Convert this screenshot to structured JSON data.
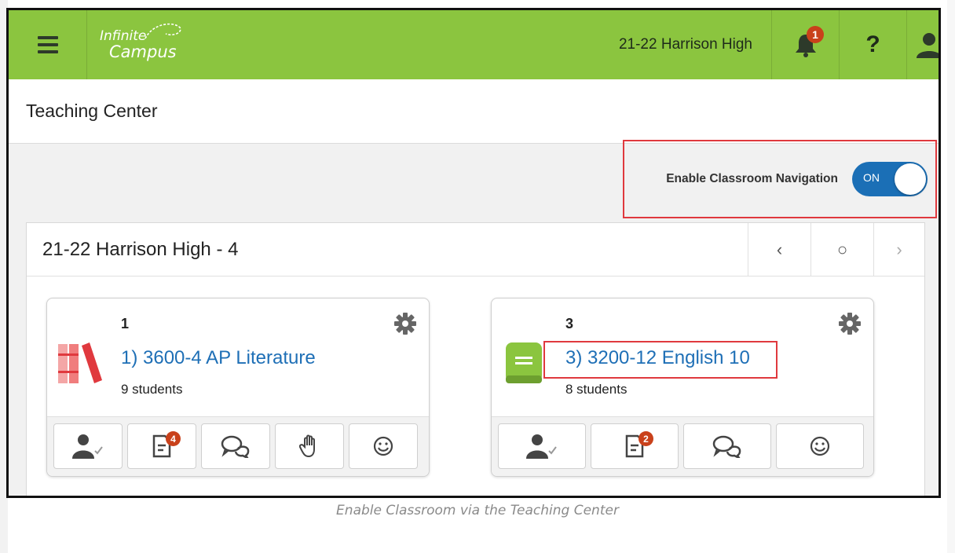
{
  "topbar": {
    "logo_line1": "Infinite",
    "logo_line2": "Campus",
    "school": "21-22 Harrison High",
    "notification_count": "1",
    "help_label": "?",
    "icons": {
      "menu": "hamburger-icon",
      "bell": "bell-icon",
      "user": "user-icon"
    }
  },
  "page_title": "Teaching Center",
  "toggle": {
    "label": "Enable Classroom Navigation",
    "state": "ON"
  },
  "term": {
    "title": "21-22 Harrison High - 4",
    "nav": {
      "prev": "‹",
      "home": "○",
      "next": "›"
    }
  },
  "courses": [
    {
      "period": "1",
      "name": "1) 3600-4 AP Literature",
      "students": "9 students",
      "icon": "books-icon",
      "actions": [
        {
          "name": "attendance-icon"
        },
        {
          "name": "grade-book-icon",
          "badge": "4"
        },
        {
          "name": "messages-icon"
        },
        {
          "name": "hand-raise-icon"
        },
        {
          "name": "smiley-icon"
        }
      ]
    },
    {
      "period": "3",
      "name": "3) 3200-12 English 10",
      "students": "8 students",
      "icon": "book-icon",
      "actions": [
        {
          "name": "attendance-icon"
        },
        {
          "name": "grade-book-icon",
          "badge": "2"
        },
        {
          "name": "messages-icon"
        },
        {
          "name": "smiley-icon"
        }
      ]
    }
  ],
  "colors": {
    "topbar": "#8bc53f",
    "accent_blue": "#1b6fb6",
    "highlight": "#e0393e",
    "badge": "#c9411b"
  },
  "caption": "Enable Classroom via the Teaching Center"
}
